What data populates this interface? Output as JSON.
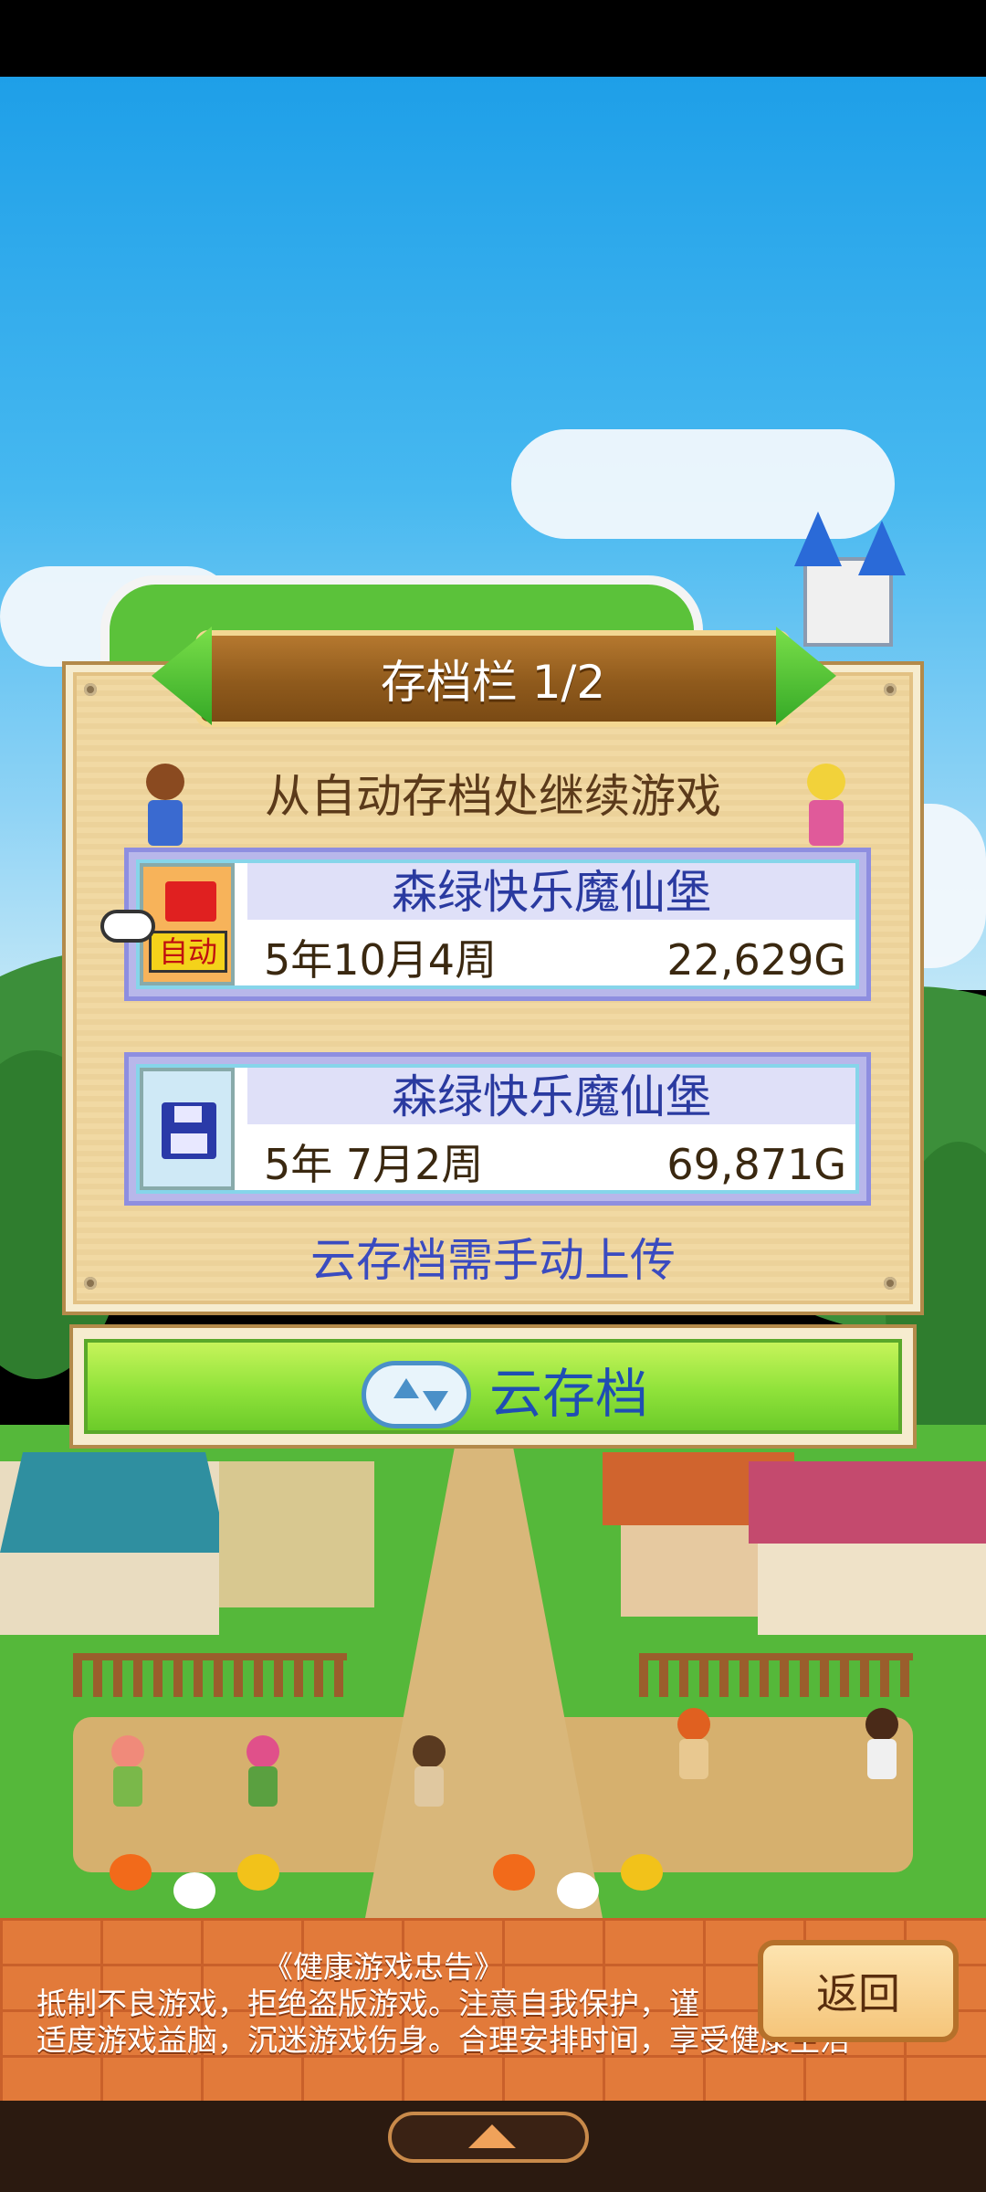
{
  "save_panel": {
    "title": "存档栏 1/2",
    "subtitle": "从自动存档处继续游戏",
    "slots": [
      {
        "name": "森绿快乐魔仙堡",
        "date": "5年10月4周",
        "gold": "22,629G",
        "badge": "自动",
        "icon": "auto-save-floppy-icon"
      },
      {
        "name": "森绿快乐魔仙堡",
        "date": "5年 7月2周",
        "gold": "69,871G",
        "icon": "floppy-disk-icon"
      }
    ],
    "cloud_note": "云存档需手动上传"
  },
  "cloud_button": {
    "label": "云存档",
    "icon": "cloud-sync-icon"
  },
  "notice": {
    "title": "《健康游戏忠告》",
    "line1": "抵制不良游戏，拒绝盗版游戏。注意自我保护，谨",
    "line2": "适度游戏益脑，沉迷游戏伤身。合理安排时间，享受健康生活"
  },
  "back_button": {
    "label": "返回"
  },
  "colors": {
    "panel": "#f1d9a3",
    "banner": "#8f5a1c",
    "slot_name": "#2a3aa0",
    "green_button": "#8fe23a",
    "brick": "#e27a3a"
  }
}
